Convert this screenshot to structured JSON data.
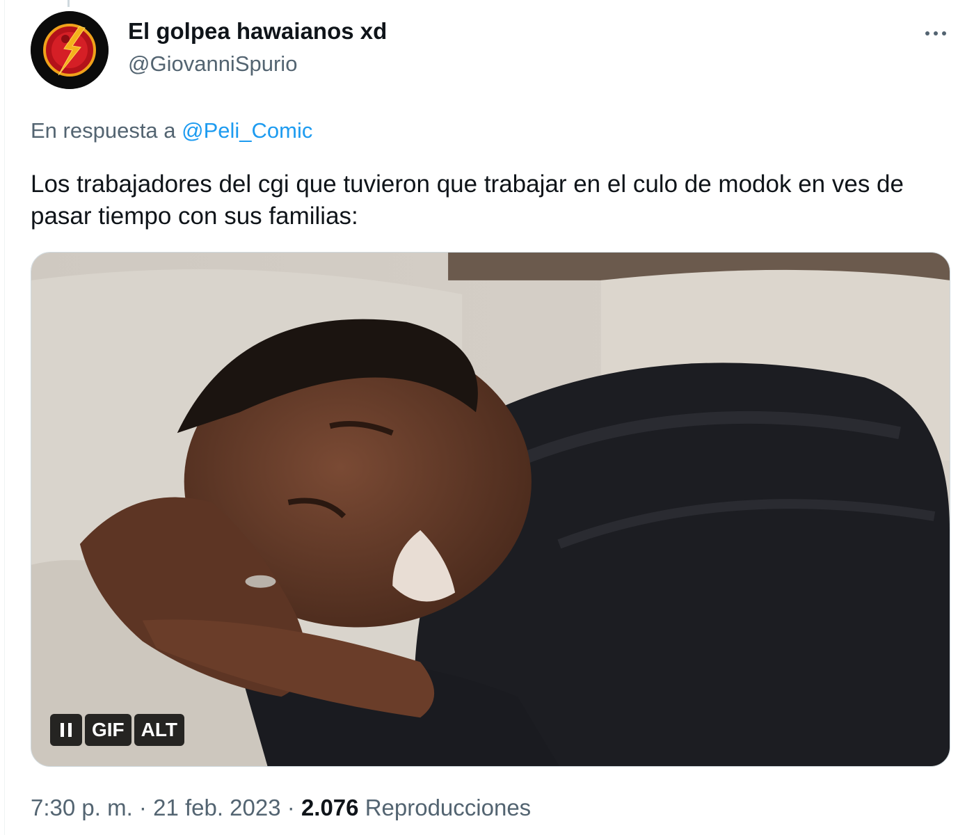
{
  "tweet": {
    "display_name": "El golpea hawaianos xd",
    "handle": "@GiovanniSpurio",
    "reply_prefix": "En respuesta a ",
    "reply_to": "@Peli_Comic",
    "text": "Los trabajadores del cgi que tuvieron que trabajar en el culo de modok en ves de pasar tiempo con sus familias:",
    "media": {
      "gif_label": "GIF",
      "alt_label": "ALT"
    },
    "time": "7:30 p. m.",
    "separator": "·",
    "date": "21 feb. 2023",
    "views_count": "2.076",
    "views_label": "Reproducciones"
  },
  "colors": {
    "accent": "#1d9bf0",
    "secondary_text": "#536471",
    "primary_text": "#0f1419"
  },
  "icons": {
    "avatar": "flash-lightning-logo",
    "more": "more-dots-icon",
    "pause": "pause-icon"
  }
}
